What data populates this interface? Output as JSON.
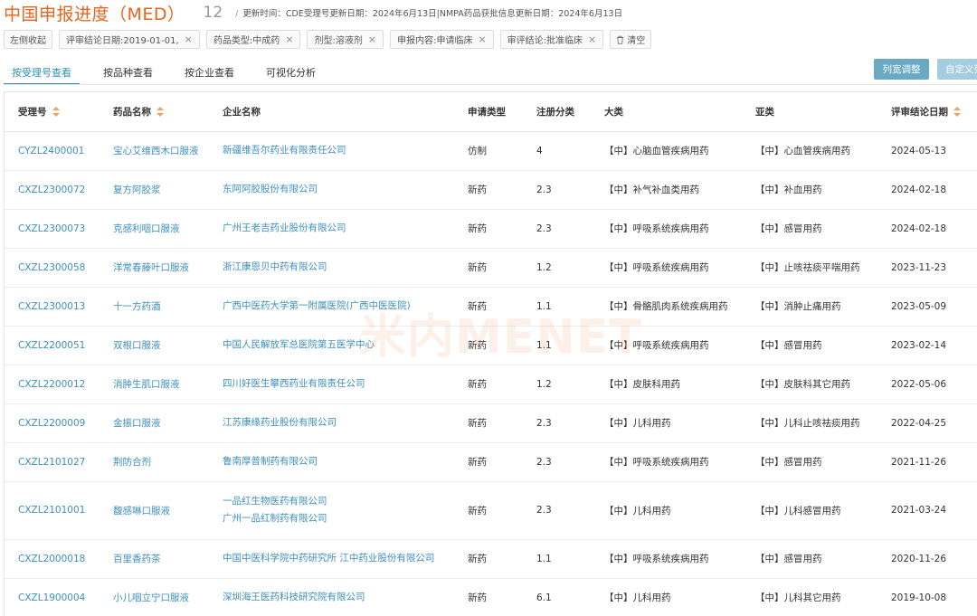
{
  "header": {
    "title": "中国申报进度（MED）",
    "count": "12",
    "update_info": "更新时间：CDE受理号更新日期：2024年6月13日|NMPA药品获批信息更新日期：2024年6月13日"
  },
  "filters": {
    "collapse_label": "左侧收起",
    "chips": [
      "评审结论日期:2019-01-01,",
      "药品类型:中成药",
      "剂型:溶液剂",
      "申报内容:申请临床",
      "审评结论:批准临床"
    ],
    "clear_label": "清空"
  },
  "tabs": [
    "按受理号查看",
    "按品种查看",
    "按企业查看",
    "可视化分析"
  ],
  "actions": {
    "adjust_width": "列宽调整",
    "custom": "自定义列"
  },
  "table": {
    "headers": [
      "受理号",
      "药品名称",
      "企业名称",
      "申请类型",
      "注册分类",
      "大类",
      "亚类",
      "评审结论日期"
    ],
    "rows": [
      {
        "id": "CYZL2400001",
        "drug": "宝心艾维西木口服液",
        "company": [
          "新疆维吾尔药业有限责任公司"
        ],
        "type": "仿制",
        "reg": "4",
        "major": "【中】心脑血管疾病用药",
        "sub": "【中】心血管疾病用药",
        "date": "2024-05-13"
      },
      {
        "id": "CXZL2300072",
        "drug": "复方阿胶浆",
        "company": [
          "东阿阿胶股份有限公司"
        ],
        "type": "新药",
        "reg": "2.3",
        "major": "【中】补气补血类用药",
        "sub": "【中】补血用药",
        "date": "2024-02-18"
      },
      {
        "id": "CXZL2300073",
        "drug": "克感利咽口服液",
        "company": [
          "广州王老吉药业股份有限公司"
        ],
        "type": "新药",
        "reg": "2.3",
        "major": "【中】呼吸系统疾病用药",
        "sub": "【中】感冒用药",
        "date": "2024-02-18"
      },
      {
        "id": "CXZL2300058",
        "drug": "洋常春藤叶口服液",
        "company": [
          "浙江康恩贝中药有限公司"
        ],
        "type": "新药",
        "reg": "1.2",
        "major": "【中】呼吸系统疾病用药",
        "sub": "【中】止咳祛痰平喘用药",
        "date": "2023-11-23"
      },
      {
        "id": "CXZL2300013",
        "drug": "十一方药酒",
        "company": [
          "广西中医药大学第一附属医院(广西中医医院)"
        ],
        "type": "新药",
        "reg": "1.1",
        "major": "【中】骨骼肌肉系统疾病用药",
        "sub": "【中】消肿止痛用药",
        "date": "2023-05-09"
      },
      {
        "id": "CXZL2200051",
        "drug": "双根口服液",
        "company": [
          "中国人民解放军总医院第五医学中心"
        ],
        "type": "新药",
        "reg": "1.1",
        "major": "【中】呼吸系统疾病用药",
        "sub": "【中】感冒用药",
        "date": "2023-02-14"
      },
      {
        "id": "CXZL2200012",
        "drug": "消肿生肌口服液",
        "company": [
          "四川好医生攀西药业有限责任公司"
        ],
        "type": "新药",
        "reg": "1.2",
        "major": "【中】皮肤科用药",
        "sub": "【中】皮肤科其它用药",
        "date": "2022-05-06"
      },
      {
        "id": "CXZL2200009",
        "drug": "金振口服液",
        "company": [
          "江苏康缘药业股份有限公司"
        ],
        "type": "新药",
        "reg": "2.3",
        "major": "【中】儿科用药",
        "sub": "【中】儿科止咳祛痰用药",
        "date": "2022-04-25"
      },
      {
        "id": "CXZL2101027",
        "drug": "荆防合剂",
        "company": [
          "鲁南厚普制药有限公司"
        ],
        "type": "新药",
        "reg": "2.3",
        "major": "【中】呼吸系统疾病用药",
        "sub": "【中】感冒用药",
        "date": "2021-11-26"
      },
      {
        "id": "CXZL2101001",
        "drug": "馥感啉口服液",
        "company": [
          "一品红生物医药有限公司",
          "广州一品红制药有限公司"
        ],
        "type": "新药",
        "reg": "2.3",
        "major": "【中】儿科用药",
        "sub": "【中】儿科感冒用药",
        "date": "2021-03-24"
      },
      {
        "id": "CXZL2000018",
        "drug": "百里香药茶",
        "company": [
          "中国中医科学院中药研究所 江中药业股份有限公司"
        ],
        "type": "新药",
        "reg": "1.1",
        "major": "【中】呼吸系统疾病用药",
        "sub": "【中】感冒用药",
        "date": "2020-11-26"
      },
      {
        "id": "CXZL1900004",
        "drug": "小儿咽立宁口服液",
        "company": [
          "深圳海王医药科技研究院有限公司"
        ],
        "type": "新药",
        "reg": "6.1",
        "major": "【中】儿科用药",
        "sub": "【中】儿科其它用药",
        "date": "2019-10-08"
      }
    ]
  },
  "watermark": "米内MENET"
}
